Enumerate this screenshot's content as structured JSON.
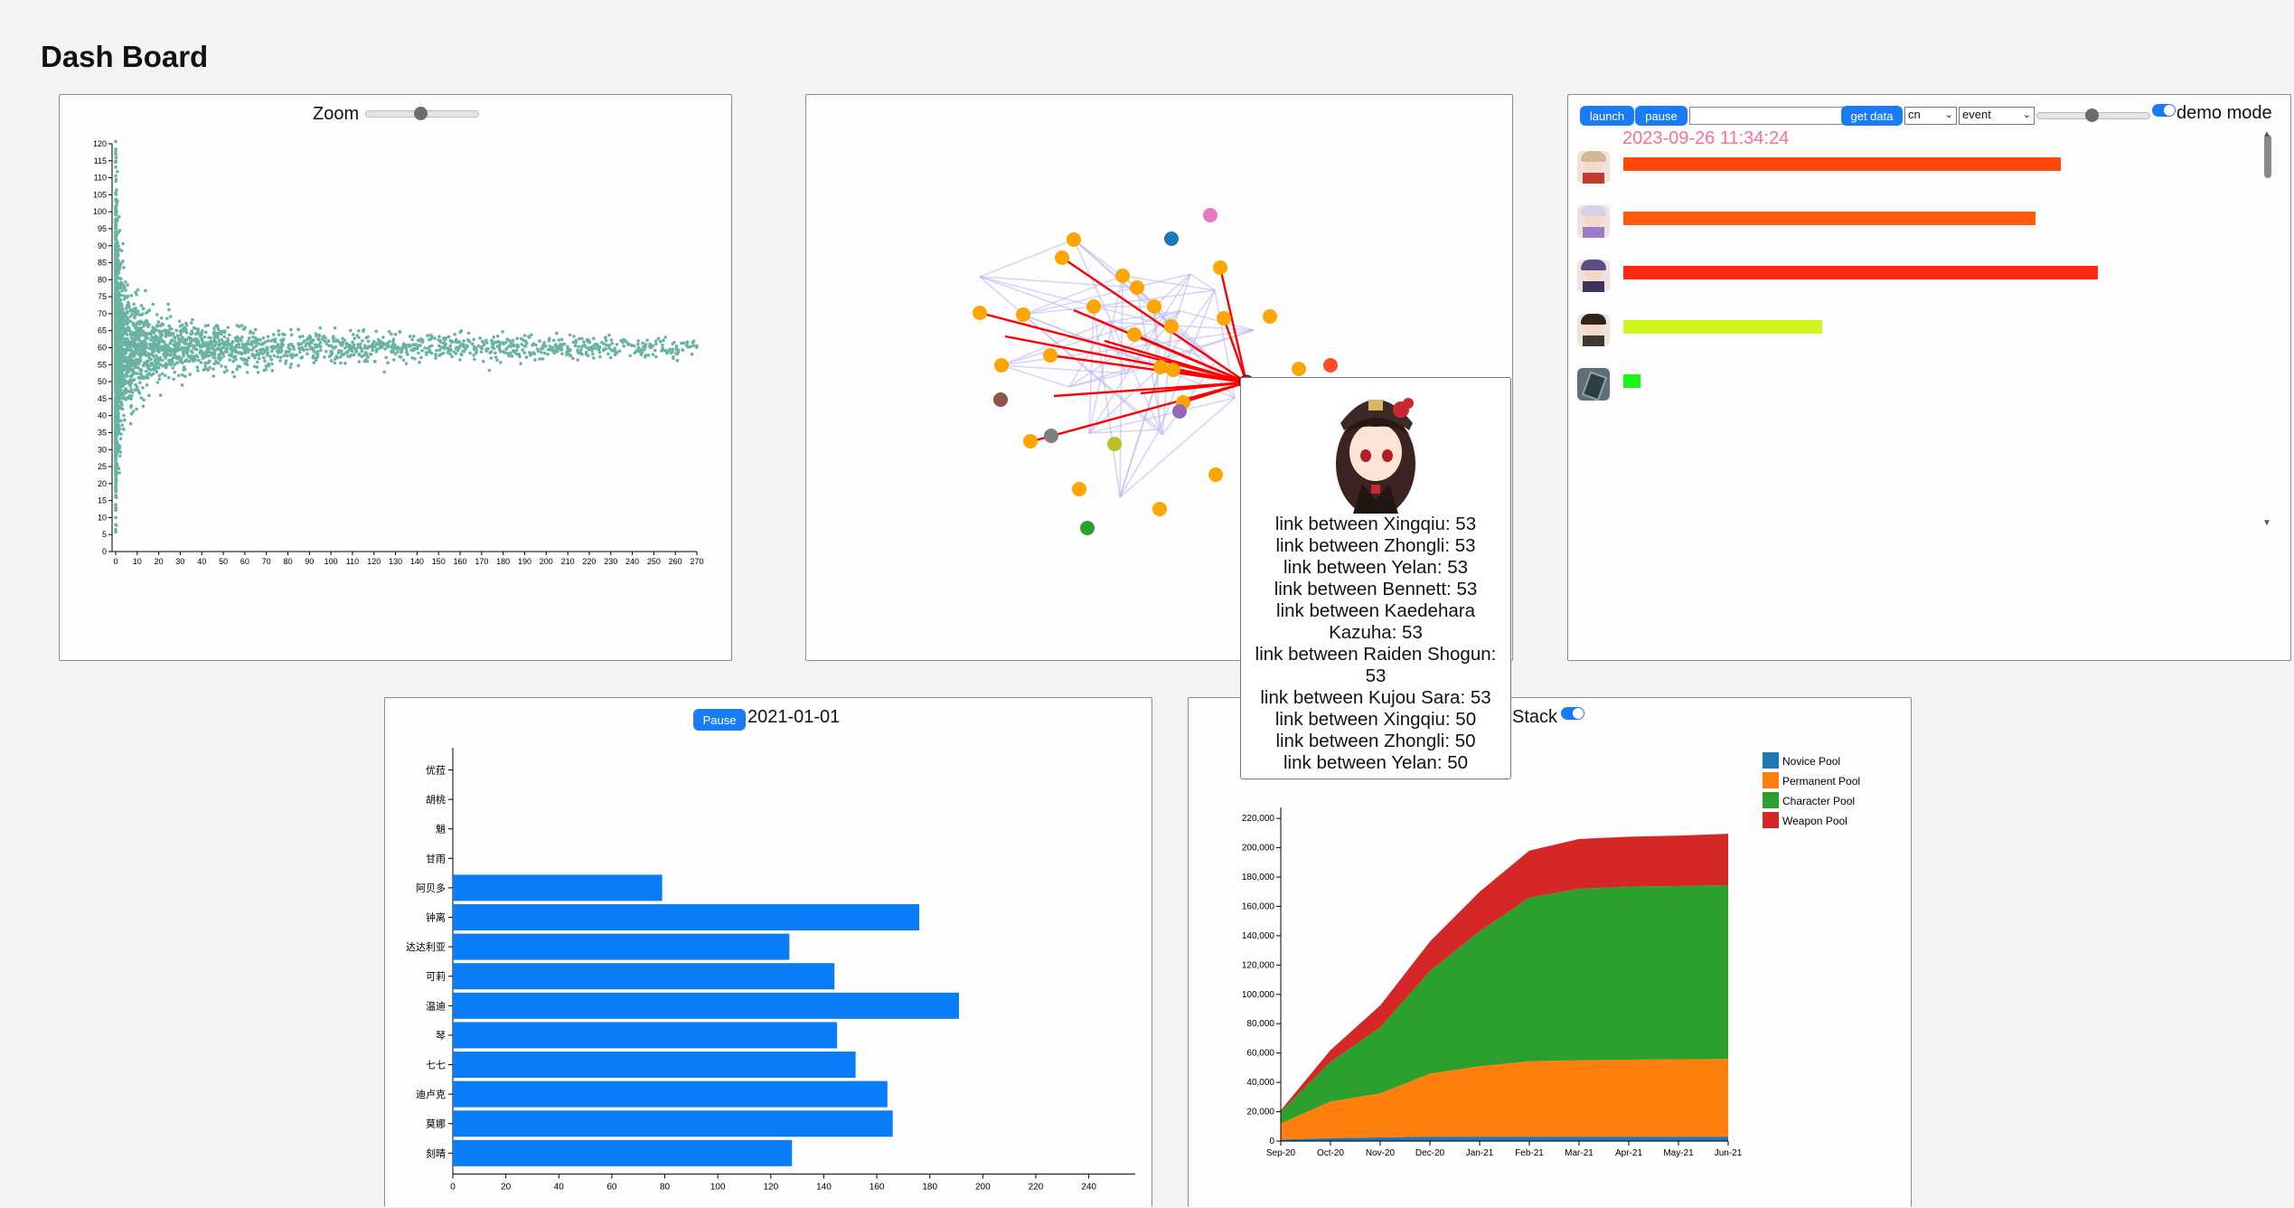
{
  "header": {
    "title": "Dash Board"
  },
  "scatter": {
    "zoom_label": "Zoom",
    "zoom_level": 0.5,
    "x_ticks": [
      0,
      10,
      20,
      30,
      40,
      50,
      60,
      70,
      80,
      90,
      100,
      110,
      120,
      130,
      140,
      150,
      160,
      170,
      180,
      190,
      200,
      210,
      220,
      230,
      240,
      250,
      260,
      270
    ],
    "y_ticks": [
      0,
      5,
      10,
      15,
      20,
      25,
      30,
      35,
      40,
      45,
      50,
      55,
      60,
      65,
      70,
      75,
      80,
      85,
      90,
      95,
      100,
      105,
      110,
      115,
      120
    ],
    "point_color": "#69b3a2"
  },
  "network": {
    "node_color": "#ffa500",
    "highlight_color": "#ff0000",
    "link_color": "#b6b6f0",
    "tooltip_lines": [
      "link between Xingqiu: 53",
      "link between Zhongli: 53",
      "link between Yelan: 53",
      "link between Bennett: 53",
      "link between Kaedehara",
      "Kazuha: 53",
      "link between Raiden Shogun:",
      "53",
      "link between Kujou Sara: 53",
      "link between Xingqiu: 50",
      "link between Zhongli: 50",
      "link between Yelan: 50"
    ]
  },
  "race": {
    "launch_label": "launch",
    "pause_label": "pause",
    "get_data_label": "get data",
    "lang_select": "cn",
    "mode_select": "event",
    "demo_label": "demo mode",
    "timestamp": "2023-09-26 11:34:24",
    "timestamp_color": "#ff6f91",
    "bars": [
      {
        "icon": "character-avatar-icon",
        "value": 0.672,
        "color": "#ff4a0a"
      },
      {
        "icon": "character-avatar-icon",
        "value": 0.634,
        "color": "#ff5a0f"
      },
      {
        "icon": "character-avatar-icon",
        "value": 0.729,
        "color": "#ff2812"
      },
      {
        "icon": "character-avatar-icon",
        "value": 0.306,
        "color": "#cdf51e"
      },
      {
        "icon": "weapon-item-icon",
        "value": 0.027,
        "color": "#19f519"
      }
    ]
  },
  "hbar": {
    "pause_label": "Pause",
    "date": "2021-01-01",
    "bar_color": "#0a7cf5",
    "x_ticks": [
      0,
      20,
      40,
      60,
      80,
      100,
      120,
      140,
      160,
      180,
      200,
      220,
      240
    ]
  },
  "stack": {
    "toggle_label": "Stack",
    "y_ticks": [
      "0",
      "20,000",
      "40,000",
      "60,000",
      "80,000",
      "100,000",
      "120,000",
      "140,000",
      "160,000",
      "180,000",
      "200,000",
      "220,000"
    ],
    "legend": [
      {
        "name": "Novice Pool",
        "color": "#1f77b4"
      },
      {
        "name": "Permanent Pool",
        "color": "#ff7f0e"
      },
      {
        "name": "Character Pool",
        "color": "#2ca02c"
      },
      {
        "name": "Weapon Pool",
        "color": "#d62728"
      }
    ]
  },
  "chart_data": [
    {
      "type": "bar",
      "orientation": "horizontal",
      "title": "2021-01-01",
      "categories": [
        "优菈",
        "胡桃",
        "魈",
        "甘雨",
        "阿贝多",
        "钟离",
        "达达利亚",
        "可莉",
        "温迪",
        "琴",
        "七七",
        "迪卢克",
        "莫娜",
        "刻晴"
      ],
      "values": [
        0,
        0,
        0,
        0,
        79,
        176,
        127,
        144,
        191,
        145,
        152,
        164,
        166,
        128
      ],
      "xlim": [
        0,
        240
      ]
    },
    {
      "type": "area",
      "stacked": true,
      "x": [
        "Sep-20",
        "Oct-20",
        "Nov-20",
        "Dec-20",
        "Jan-21",
        "Feb-21",
        "Mar-21",
        "Apr-21",
        "May-21",
        "Jun-21"
      ],
      "series": [
        {
          "name": "Novice Pool",
          "values": [
            1000,
            2000,
            2500,
            3000,
            3000,
            3000,
            3000,
            3000,
            3000,
            3000
          ]
        },
        {
          "name": "Permanent Pool",
          "values": [
            11000,
            25000,
            30000,
            43000,
            48000,
            51500,
            52000,
            52500,
            52800,
            53000
          ]
        },
        {
          "name": "Character Pool",
          "values": [
            8000,
            27000,
            45000,
            70000,
            92000,
            111500,
            117000,
            118000,
            118000,
            118500
          ]
        },
        {
          "name": "Weapon Pool",
          "values": [
            1000,
            8000,
            15000,
            20000,
            27000,
            32000,
            34000,
            34000,
            34500,
            35000
          ]
        }
      ],
      "ylim": [
        0,
        225000
      ]
    },
    {
      "type": "scatter",
      "description_of_shape": "",
      "xlim": [
        0,
        270
      ],
      "ylim": [
        0,
        120
      ]
    }
  ]
}
